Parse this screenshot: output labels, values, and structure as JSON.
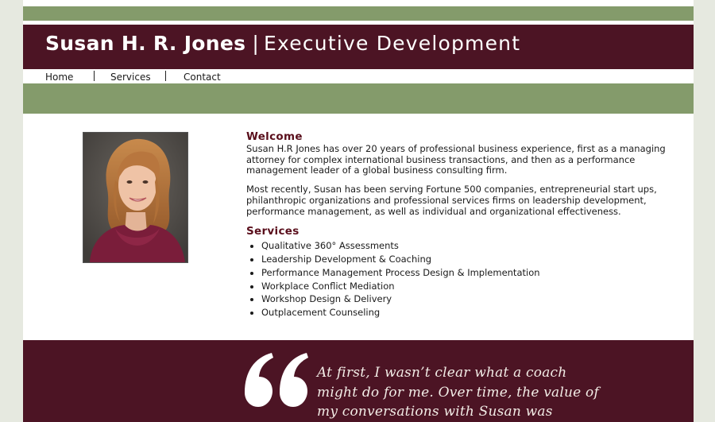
{
  "site": {
    "name": "Susan H. R. Jones",
    "separator": "|",
    "tagline": "Executive Development"
  },
  "nav": {
    "items": [
      "Home",
      "Services",
      "Contact"
    ]
  },
  "photo": {
    "icon": "portrait-photo"
  },
  "welcome": {
    "heading": "Welcome",
    "paragraphs": [
      "Susan H.R Jones has over 20 years of professional business experience, first as a managing attorney for complex international business transactions, and then as a performance management leader of a global business consulting firm.",
      "Most recently, Susan has been serving Fortune 500 companies, entrepreneurial start ups, philanthropic organizations and professional services firms on leadership development, performance management, as well as individual and organizational effectiveness."
    ]
  },
  "services": {
    "heading": "Services",
    "items": [
      "Qualitative 360° Assessments",
      "Leadership Development & Coaching",
      "Performance Management Process Design & Implementation",
      "Workplace Conflict Mediation",
      "Workshop Design & Delivery",
      "Outplacement Counseling"
    ]
  },
  "testimonial": {
    "icon": "quote-mark-icon",
    "lines": [
      "At first, I wasn’t clear what a coach",
      "might do for me. Over time, the value of",
      "my conversations with Susan was"
    ]
  },
  "colors": {
    "maroon": "#4c1424",
    "green": "#849b6b",
    "heading": "#5a0f1c"
  }
}
